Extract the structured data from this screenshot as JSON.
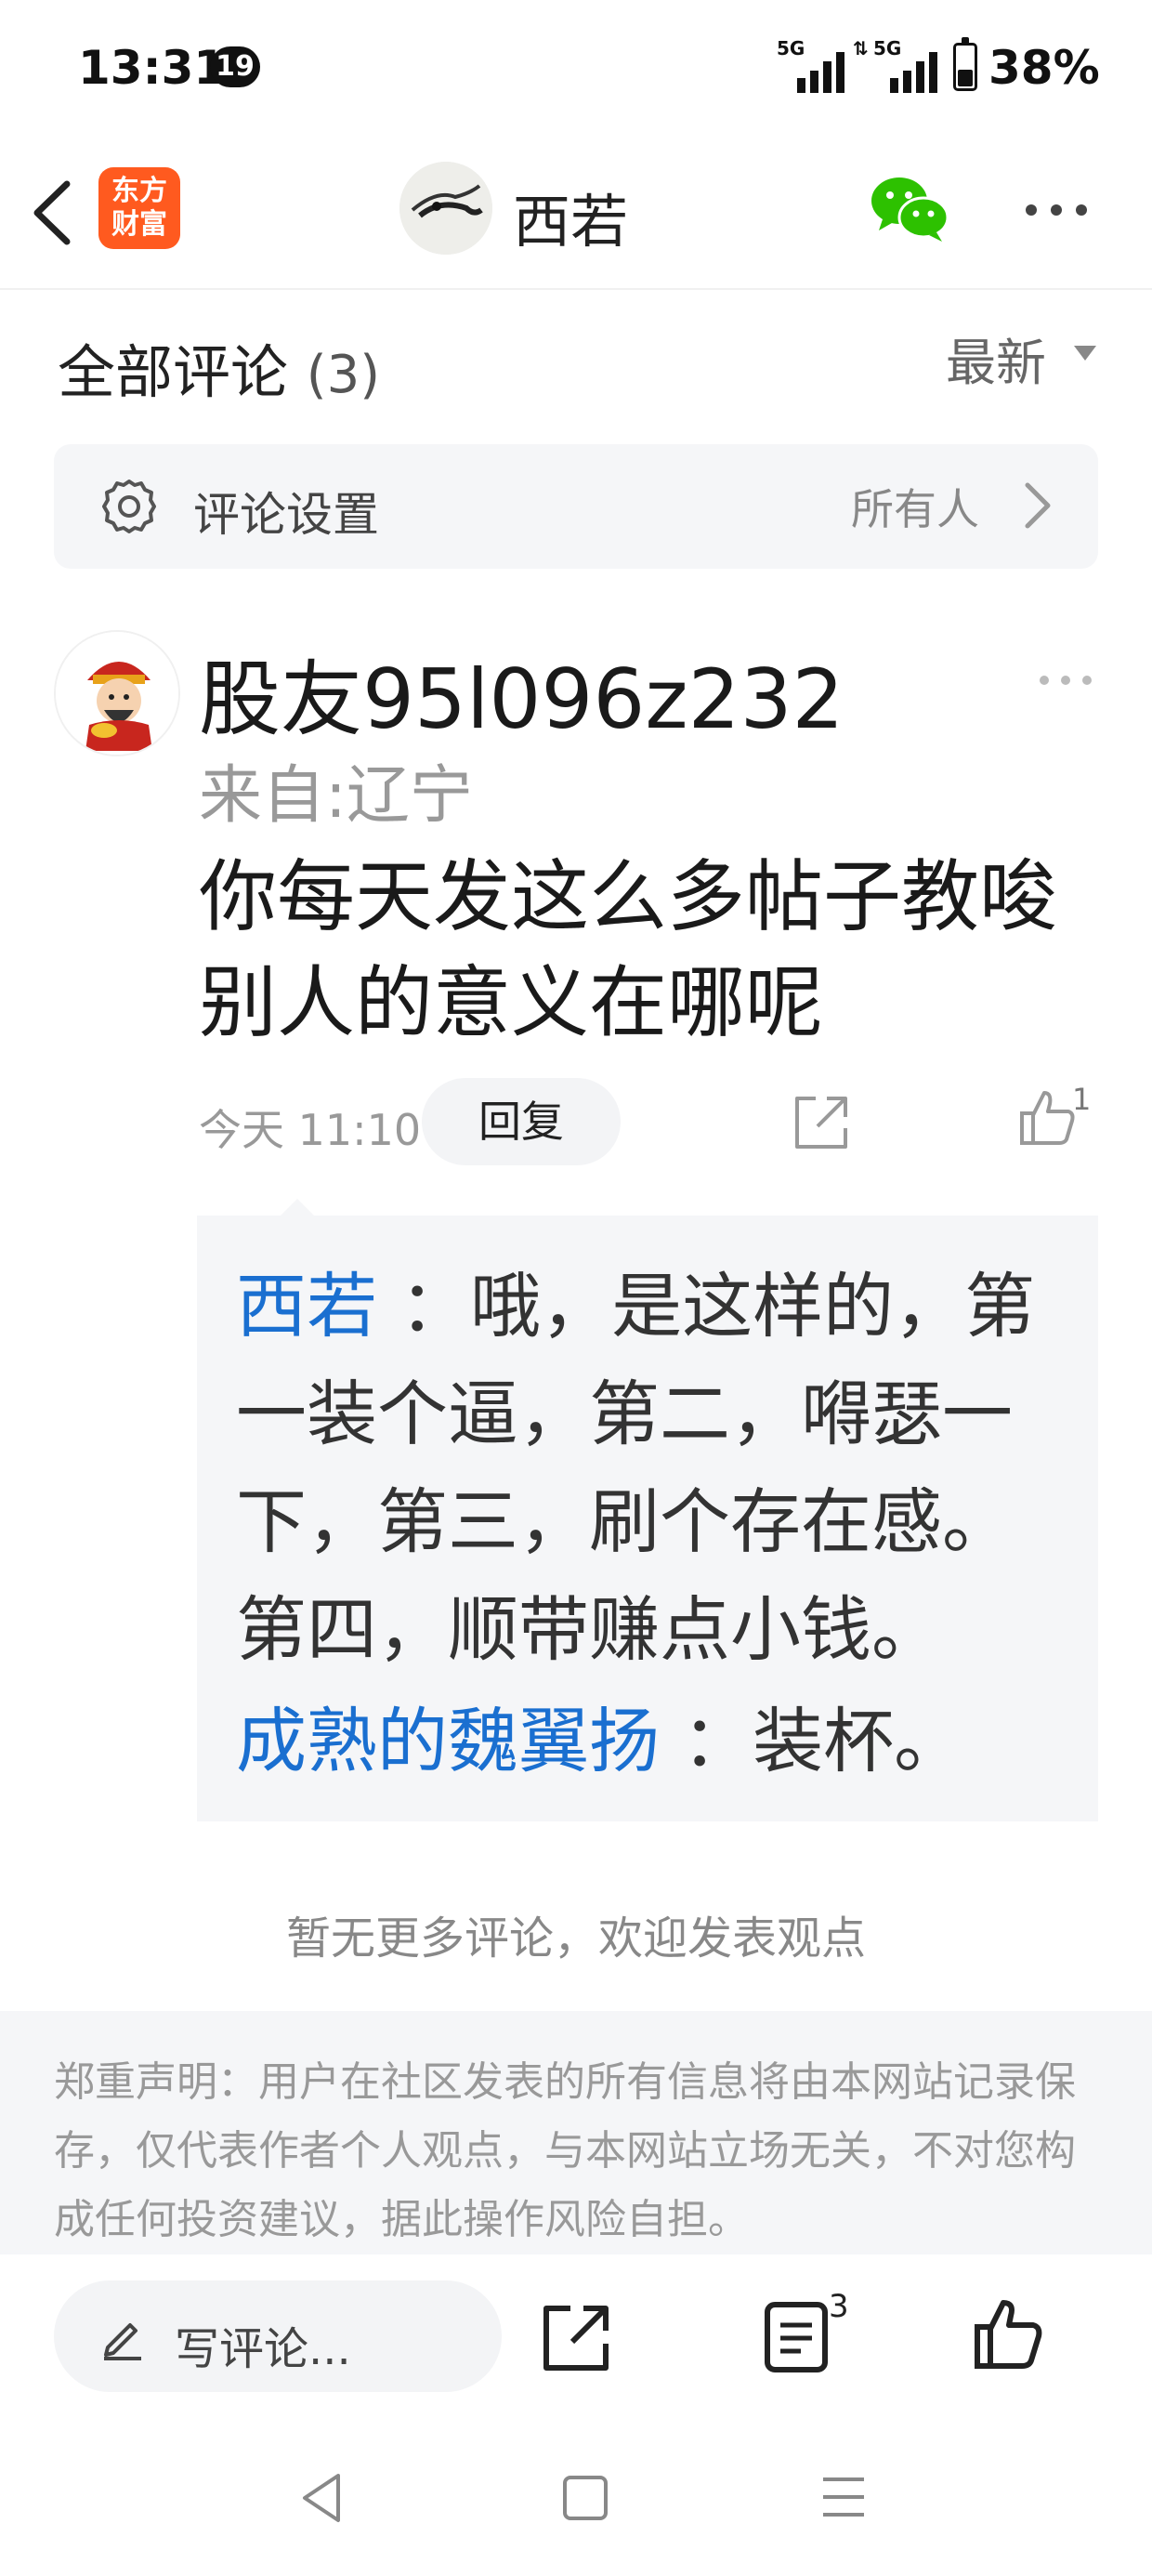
{
  "status_bar": {
    "time": "13:31",
    "notification_count": "19",
    "signal_1_label": "5G",
    "signal_2_label": "5G",
    "battery": "38%"
  },
  "header": {
    "app_logo_text": "东方财富",
    "title": "西若"
  },
  "comments": {
    "title": "全部评论",
    "count": "(3)",
    "sort_label": "最新"
  },
  "settings": {
    "label": "评论设置",
    "value": "所有人"
  },
  "comment": {
    "username": "股友95l096z232",
    "location": "来自:辽宁",
    "text": "你每天发这么多帖子教唆别人的意义在哪呢",
    "time": "今天 11:10",
    "reply_label": "回复",
    "like_count": "1",
    "replies": [
      {
        "author": "西若",
        "text": "：哦，是这样的，第一装个逼，第二，嘚瑟一下，第三，刷个存在感。第四，顺带赚点小钱。"
      },
      {
        "author": "成熟的魏翼扬",
        "text": "：装杯。"
      }
    ]
  },
  "no_more_text": "暂无更多评论，欢迎发表观点",
  "disclaimer": "郑重声明：用户在社区发表的所有信息将由本网站记录保存，仅代表作者个人观点，与本网站立场无关，不对您构成任何投资建议，据此操作风险自担。",
  "bottom_bar": {
    "write_placeholder": "写评论...",
    "list_count": "3"
  },
  "colors": {
    "accent_blue": "#1a6fd0",
    "logo_orange": "#ff5a1f",
    "wechat_green": "#2dc100"
  }
}
